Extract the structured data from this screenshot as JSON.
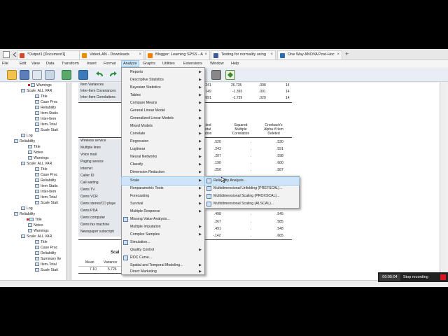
{
  "menubar": {
    "items": [
      "File",
      "Edit",
      "View",
      "Data",
      "Transform",
      "Insert",
      "Format",
      "Analyze",
      "Graphs",
      "Utilities",
      "Extensions",
      "Window",
      "Help"
    ]
  },
  "tabs": [
    {
      "label": "*Output1 [Document1]",
      "color": "#d9462c"
    },
    {
      "label": "VideoLAN - Downloads",
      "color": "#f08a00"
    },
    {
      "label": "Blogger: Learning SPSS - A",
      "color": "#f57d00"
    },
    {
      "label": "Testing for normality using",
      "color": "#3d5a99"
    },
    {
      "label": "One Way ANOVA Post-Hoc",
      "color": "#2b6cb0"
    }
  ],
  "outline": [
    "Warnings",
    "Scale: ALL VAR",
    "Title",
    "Case Proc",
    "Reliability",
    "Item-Statis",
    "Inter-Item",
    "Item-Total",
    "Scale Stati",
    "Log",
    "Reliability",
    "Title",
    "Notes",
    "Warnings",
    "Scale: ALL VAR",
    "Title",
    "Case Proc",
    "Reliability",
    "Item Statis",
    "Inter-Item",
    "Item-Total",
    "Scale Stati",
    "Log",
    "Reliability",
    "Title",
    "Notes",
    "Warnings",
    "Scale: ALL VAR",
    "Title",
    "Case Proc",
    "Reliability",
    "Summary Ite",
    "Item-Total",
    "Scale Stati"
  ],
  "summary_table": {
    "rows": [
      {
        "label": "Item Variances",
        "a": ".241",
        "b": "26.735",
        "c": ".008",
        "d": "14"
      },
      {
        "label": "Inter-Item Covariances",
        "a": ".149",
        "b": "-1.393",
        "c": ".001",
        "d": "14"
      },
      {
        "label": "Inter-Item Correlations",
        "a": ".691",
        "b": "-1.729",
        "c": ".020",
        "d": "14"
      }
    ]
  },
  "item_total": {
    "headers": [
      "rrected\nn-Total\nrelation",
      "Squared\nMultiple\nCorrelation",
      "Cronbach's\nAlpha if Item\nDeleted"
    ],
    "rows": [
      {
        "label": "Wireless service",
        "a": ".520",
        "b": ".",
        "c": ".530"
      },
      {
        "label": "Multiple lines",
        "a": ".243",
        "b": ".",
        "c": ".591"
      },
      {
        "label": "Voice mail",
        "a": ".207",
        "b": ".",
        "c": ".598"
      },
      {
        "label": "Paging service",
        "a": ".190",
        "b": ".",
        "c": ".600"
      },
      {
        "label": "Internet",
        "a": ".250",
        "b": ".",
        "c": ".587"
      },
      {
        "label": "Caller ID",
        "a": "",
        "b": "",
        "c": ""
      },
      {
        "label": "Call waiting",
        "a": "",
        "b": "",
        "c": ""
      },
      {
        "label": "Owns TV",
        "a": "",
        "b": "",
        "c": ""
      },
      {
        "label": "Owns VCR",
        "a": "",
        "b": "",
        "c": ""
      },
      {
        "label": "Owns stereo/CD playe",
        "a": "",
        "b": "",
        "c": ""
      },
      {
        "label": "Owns PDA",
        "a": ".498",
        "b": ".",
        "c": ".545"
      },
      {
        "label": "Owns computer",
        "a": ".267",
        "b": ".",
        "c": ".585"
      },
      {
        "label": "Owns fax machine",
        "a": ".491",
        "b": ".",
        "c": ".548"
      },
      {
        "label": "Newspaper subscripti",
        "a": "-.142",
        "b": ".",
        "c": ".665"
      }
    ]
  },
  "scale_stats": {
    "title": "Scal",
    "headers": [
      "Mean",
      "Variance"
    ],
    "values": [
      "7.10",
      "5.726"
    ]
  },
  "analyze_menu": [
    {
      "label": "Reports",
      "sub": true
    },
    {
      "label": "Descriptive Statistics",
      "sub": true
    },
    {
      "label": "Bayesian Statistics",
      "sub": true
    },
    {
      "label": "Tables",
      "sub": true
    },
    {
      "label": "Compare Means",
      "sub": true
    },
    {
      "label": "General Linear Model",
      "sub": true
    },
    {
      "label": "Generalized Linear Models",
      "sub": true
    },
    {
      "label": "Mixed Models",
      "sub": true
    },
    {
      "label": "Correlate",
      "sub": true
    },
    {
      "label": "Regression",
      "sub": true
    },
    {
      "label": "Loglinear",
      "sub": true
    },
    {
      "label": "Neural Networks",
      "sub": true
    },
    {
      "label": "Classify",
      "sub": true
    },
    {
      "label": "Dimension Reduction",
      "sub": true
    },
    {
      "label": "Scale",
      "sub": true
    },
    {
      "label": "Nonparametric Tests",
      "sub": true
    },
    {
      "label": "Forecasting",
      "sub": true
    },
    {
      "label": "Survival",
      "sub": true
    },
    {
      "label": "Multiple Response",
      "sub": true
    },
    {
      "label": "Missing Value Analysis...",
      "sub": false
    },
    {
      "label": "Multiple Imputation",
      "sub": true
    },
    {
      "label": "Complex Samples",
      "sub": true
    },
    {
      "label": "Simulation...",
      "sub": false
    },
    {
      "label": "Quality Control",
      "sub": true
    },
    {
      "label": "ROC Curve...",
      "sub": false
    },
    {
      "label": "Spatial and Temporal Modeling...",
      "sub": true
    },
    {
      "label": "Direct Marketing",
      "sub": true
    }
  ],
  "scale_submenu": [
    "Reliability Analysis...",
    "Multidimensional Unfolding (PREFSCAL)...",
    "Multidimensional Scaling (PROXSCAL)...",
    "Multidimensional Scaling (ALSCAL)..."
  ],
  "recorder": {
    "time": "00:05:04",
    "label": "Stop recording"
  }
}
